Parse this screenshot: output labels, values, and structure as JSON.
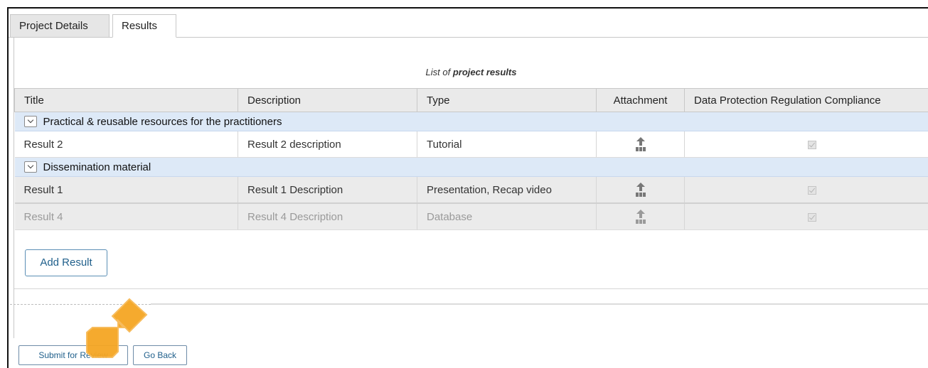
{
  "tabs": [
    {
      "label": "Project Details"
    },
    {
      "label": "Results"
    }
  ],
  "caption": {
    "prefix": "List of",
    "emphasis": "project results"
  },
  "table": {
    "headers": [
      "Title",
      "Description",
      "Type",
      "Attachment",
      "Data Protection Regulation Compliance"
    ],
    "groups": [
      {
        "label": "Practical & reusable resources for the practitioners",
        "rows": [
          {
            "title": "Result 2",
            "description": "Result 2 description",
            "type": "Tutorial"
          }
        ]
      },
      {
        "label": "Dissemination material",
        "rows": [
          {
            "title": "Result 1",
            "description": "Result 1 Description",
            "type": "Presentation, Recap video"
          },
          {
            "title": "Result 4",
            "description": "Result 4 Description",
            "type": "Database"
          }
        ]
      }
    ]
  },
  "buttons": {
    "add_result": "Add Result",
    "submit_for_review": "Submit for Review",
    "go_back": "Go Back"
  },
  "colors": {
    "group_row": "#dde9f7",
    "header_row": "#eaeaea",
    "button_text": "#1f5f8b",
    "annotation_arrow": "#f5a623"
  },
  "icons": {
    "attachment": "upload-icon",
    "compliance": "checkbox-checked-icon",
    "group_toggle": "chevron-down-icon",
    "annotation": "arrow-pointer-annotation"
  }
}
